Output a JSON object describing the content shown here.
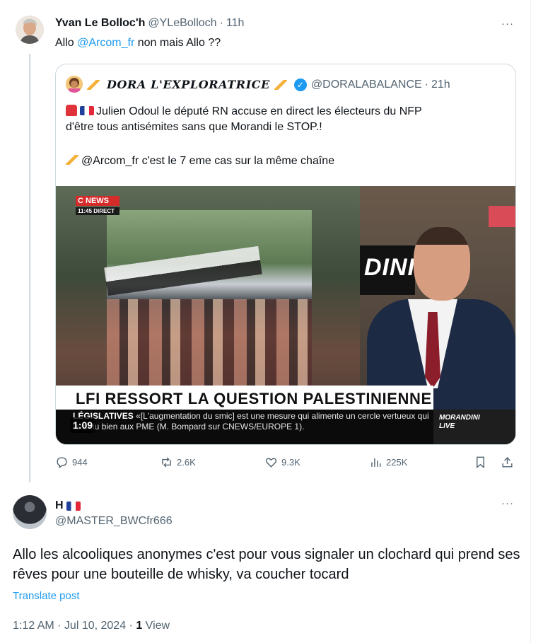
{
  "tweet": {
    "author_name": "Yvan Le Bolloc'h",
    "handle": "@YLeBolloch",
    "separator": "·",
    "time": "11h",
    "more": "···",
    "text_prefix": "Allo ",
    "text_mention": "@Arcom_fr",
    "text_suffix": " non mais Allo ??"
  },
  "quote": {
    "author_name": "DORA L'EXPLORATRICE",
    "handle": "@DORALABALANCE",
    "separator": "·",
    "time": "21h",
    "line1": "Julien Odoul le député RN accuse en direct  les électeurs du NFP",
    "line2": "d'être tous antisémites sans que Morandi le STOP.!",
    "line3": "@Arcom_fr c'est le 7 eme cas sur la même chaîne",
    "video": {
      "channel": "C NEWS",
      "clock": "11:45 DIRECT",
      "side_text": "DINI",
      "headline": "LFI RESSORT LA QUESTION PALESTINIENNE",
      "ticker_label": "LÉGISLATIVES",
      "ticker": "«[L'augmentation du smic] est une mesure qui alimente un cercle vertueux qui fera du bien aux PME (M. Bompard sur CNEWS/EUROPE 1).",
      "show": "MORANDINI",
      "show_sub": "LIVE",
      "duration": "1:09"
    }
  },
  "actions": {
    "replies": "944",
    "reposts": "2.6K",
    "likes": "9.3K",
    "views": "225K"
  },
  "reply": {
    "author_name": "H",
    "handle": "@MASTER_BWCfr666",
    "more": "···",
    "body": "Allo les alcooliques anonymes c'est pour vous signaler un clochard qui prend ses rêves pour une bouteille de whisky, va coucher tocard",
    "translate": "Translate post",
    "timestamp": "1:12 AM · Jul 10, 2024 · ",
    "views_count": "1",
    "views_label": " View"
  },
  "colors": {
    "accent": "#1d9bf0",
    "secondary_text": "#536471",
    "border": "#cfd9de"
  },
  "icons": {
    "reply": "speech-bubble-icon",
    "repost": "repost-arrows-icon",
    "like": "heart-icon",
    "views": "bar-chart-icon",
    "bookmark": "bookmark-icon",
    "share": "share-icon",
    "verified": "verified-badge-icon"
  }
}
